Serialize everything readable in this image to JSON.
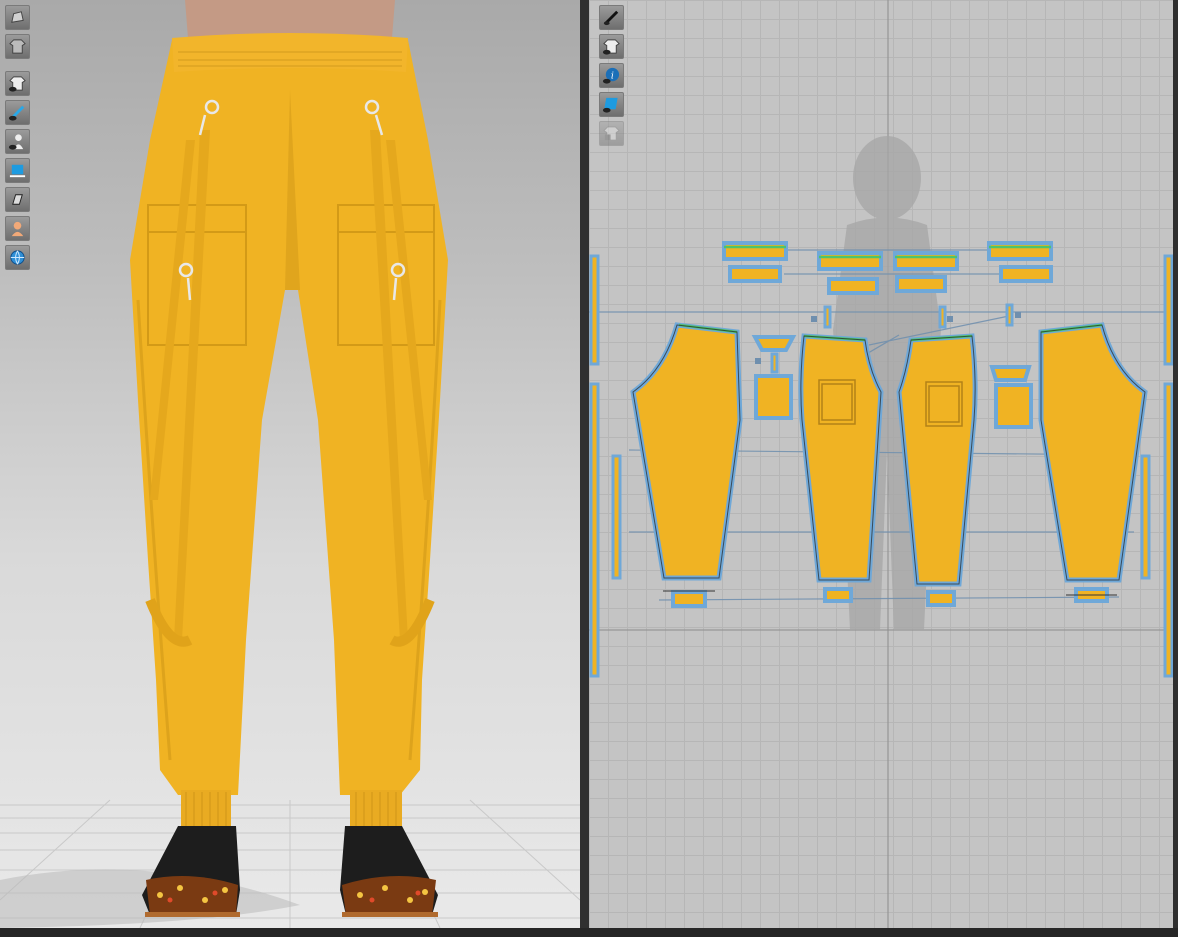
{
  "colors": {
    "fabric": "#f0b323",
    "fabric_shadow": "#c98f14",
    "fabric_light": "#f7c445",
    "piece_outline": "#6fa8d8",
    "seam_green": "#4fc46a",
    "avatar_silhouette": "#a6a6a6",
    "viewport_3d_top": "#a9a9a9",
    "viewport_3d_bottom": "#e9e9e9",
    "viewport_2d": "#c4c4c4",
    "toolbar_button": "#8a8a8a"
  },
  "toolbar_3d": [
    {
      "icon": "garment-display-icon"
    },
    {
      "icon": "garment-texture-icon"
    },
    {
      "icon": "show-garment-icon"
    },
    {
      "icon": "show-garment-edit-icon"
    },
    {
      "icon": "show-avatar-icon"
    },
    {
      "icon": "fabric-render-icon"
    },
    {
      "icon": "render-mode-icon"
    },
    {
      "icon": "avatar-skin-icon"
    },
    {
      "icon": "environment-globe-icon"
    }
  ],
  "toolbar_2d": [
    {
      "icon": "pattern-pen-icon"
    },
    {
      "icon": "show-2d-garment-icon"
    },
    {
      "icon": "info-icon"
    },
    {
      "icon": "2d-fabric-texture-icon"
    },
    {
      "icon": "locked-garment-icon"
    }
  ]
}
